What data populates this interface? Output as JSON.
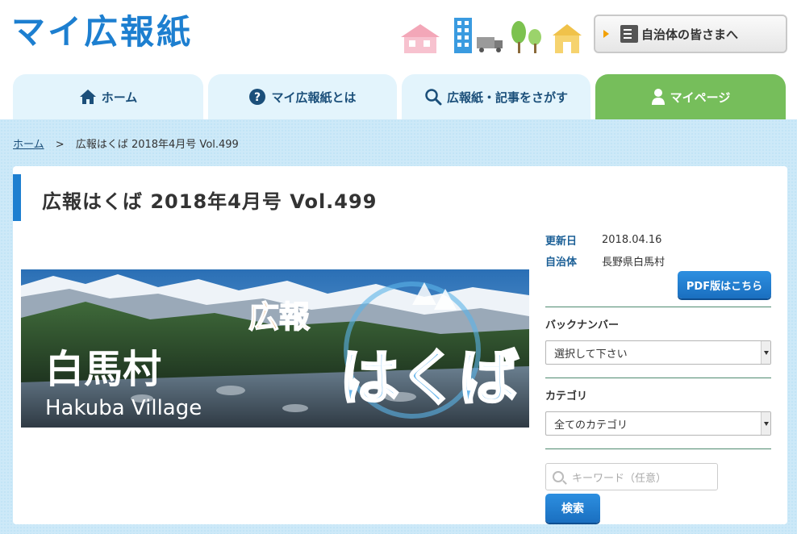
{
  "header": {
    "logo": "マイ広報紙",
    "municipality_button": "自治体の皆さまへ"
  },
  "tabs": [
    {
      "label": "ホーム",
      "icon": "home-icon"
    },
    {
      "label": "マイ広報紙とは",
      "icon": "question-icon"
    },
    {
      "label": "広報紙・記事をさがす",
      "icon": "search-icon"
    },
    {
      "label": "マイページ",
      "icon": "user-icon"
    }
  ],
  "breadcrumb": {
    "home": "ホーム",
    "separator": ">",
    "current": "広報はくば 2018年4月号 Vol.499"
  },
  "page": {
    "title": "広報はくば 2018年4月号 Vol.499"
  },
  "cover": {
    "title_small": "広報",
    "title_big": "はくば",
    "village_jp": "白馬村",
    "village_en": "Hakuba Village"
  },
  "meta": {
    "updated_label": "更新日",
    "updated_value": "2018.04.16",
    "municipality_label": "自治体",
    "municipality_value": "長野県白馬村"
  },
  "pdf_button": "PDF版はこちら",
  "backnumber": {
    "label": "バックナンバー",
    "selected": "選択して下さい"
  },
  "category": {
    "label": "カテゴリ",
    "selected": "全てのカテゴリ"
  },
  "search": {
    "placeholder": "キーワード（任意）",
    "button": "検索"
  },
  "colors": {
    "brand_blue": "#1d7fd0",
    "mypage_green": "#76be5b",
    "tab_light_blue": "#e3f4fc",
    "background_blue": "#cde9f8"
  }
}
